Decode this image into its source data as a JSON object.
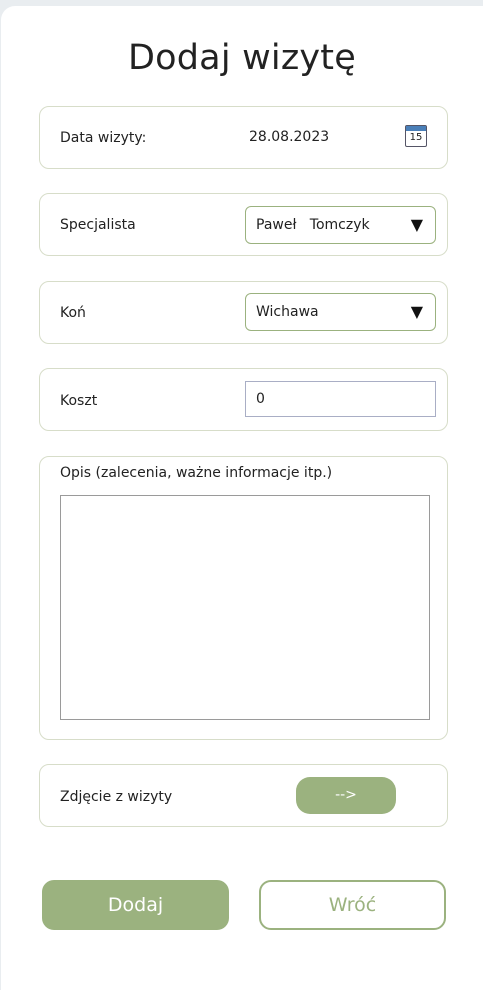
{
  "title": "Dodaj wizytę",
  "date_card": {
    "label": "Data wizyty:",
    "value": "28.08.2023",
    "calendar_day": "15"
  },
  "specialist": {
    "label": "Specjalista",
    "selected": "Paweł   Tomczyk",
    "arrow": "▼"
  },
  "horse": {
    "label": "Koń",
    "selected": "Wichawa",
    "arrow": "▼"
  },
  "cost": {
    "label": "Koszt",
    "value": "0"
  },
  "description": {
    "label": "Opis (zalecenia, ważne informacje itp.)",
    "value": ""
  },
  "photo": {
    "label": "Zdjęcie z wizyty",
    "button": "-->"
  },
  "actions": {
    "add": "Dodaj",
    "back": "Wróć"
  },
  "colors": {
    "accent": "#9bb27f",
    "card_border": "#d7ddc9"
  }
}
